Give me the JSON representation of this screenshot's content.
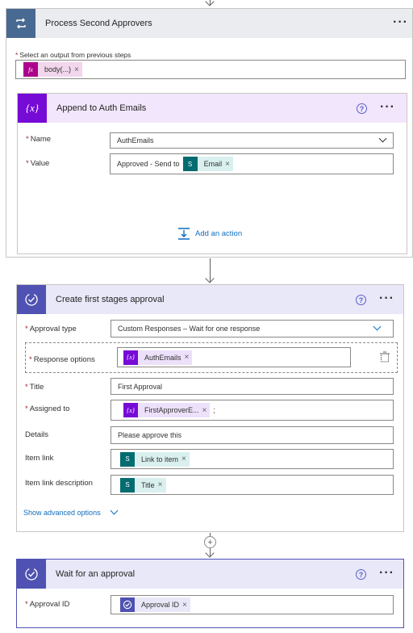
{
  "process": {
    "title": "Process Second Approvers",
    "select_label": "Select an output from previous steps",
    "token": "body(...)"
  },
  "append": {
    "title": "Append to Auth Emails",
    "name_label": "Name",
    "name_value": "AuthEmails",
    "value_label": "Value",
    "value_prefix": "Approved - Send to",
    "value_token": "Email",
    "add_action": "Add an action"
  },
  "approval": {
    "title": "Create first stages approval",
    "type_label": "Approval type",
    "type_value": "Custom Responses – Wait for one response",
    "response_label": "Response options",
    "response_token": "AuthEmails",
    "title_label": "Title",
    "title_value": "First Approval",
    "assigned_label": "Assigned to",
    "assigned_token": "FirstApproverE...",
    "assigned_suffix": ";",
    "details_label": "Details",
    "details_value": "Please approve this",
    "item_link_label": "Item link",
    "item_link_token": "Link to item",
    "item_link_desc_label": "Item link description",
    "item_link_desc_token": "Title",
    "show_advanced": "Show advanced options"
  },
  "wait": {
    "title": "Wait for an approval",
    "id_label": "Approval ID",
    "id_token": "Approval ID"
  },
  "icons": {
    "fx": "fx",
    "variable": "{x}",
    "sharepoint": "S",
    "close": "×"
  },
  "colors": {
    "loop": "#486991",
    "variable": "#770bd6",
    "approval": "#4f52b2",
    "sharepoint": "#036c70",
    "expression": "#ad008c"
  }
}
